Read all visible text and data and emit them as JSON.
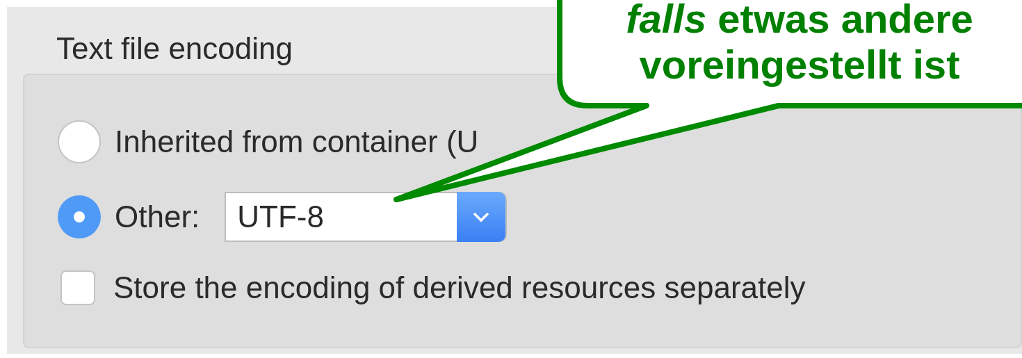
{
  "group": {
    "title": "Text file encoding",
    "options": [
      {
        "kind": "radio",
        "label": "Inherited from container (U",
        "selected": false
      },
      {
        "kind": "popup",
        "label": "Other:",
        "selected": true,
        "value": "UTF-8"
      }
    ],
    "checkbox": {
      "label": "Store the encoding of derived resources separately",
      "checked": false
    }
  },
  "callout": {
    "lines": [
      "*falls* etwas andere",
      "voreingestellt ist"
    ]
  }
}
